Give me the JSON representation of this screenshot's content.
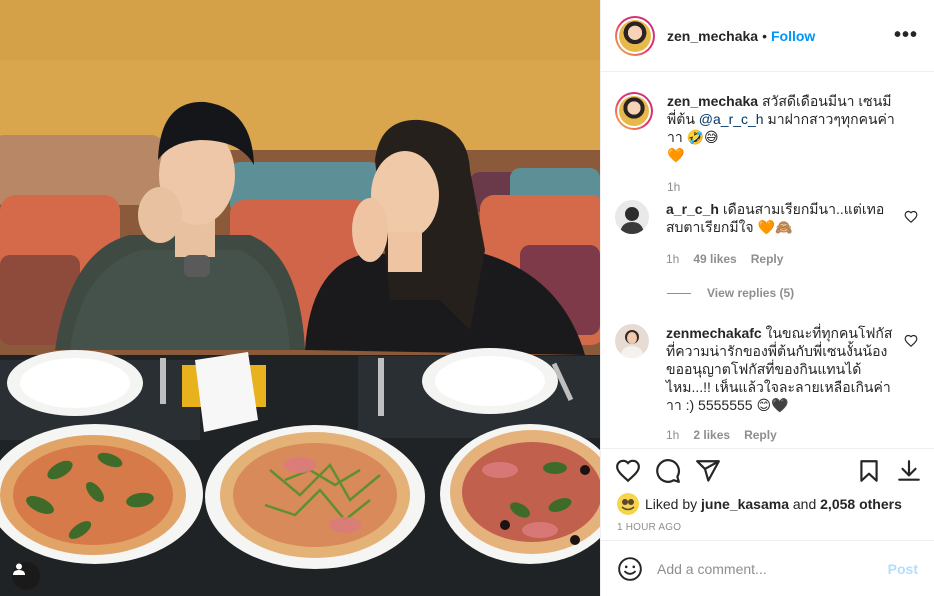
{
  "header": {
    "username": "zen_mechaka",
    "separator": "•",
    "follow_label": "Follow",
    "more_label": "•••"
  },
  "caption": {
    "username": "zen_mechaka",
    "text_before": "สวัสดีเดือนมีนา เซนมีพี่ต้น",
    "mention": "@a_r_c_h",
    "text_after": "มาฝากสาวๆทุกคนค่าาา 🤣😅",
    "emoji_line": "🧡",
    "time": "1h"
  },
  "comments": [
    {
      "username": "a_r_c_h",
      "text": "เดือนสามเรียกมีนา..แต่เทอสบตาเรียกมีใจ 🧡🙈",
      "time": "1h",
      "likes": "49 likes",
      "reply_label": "Reply"
    },
    {
      "username": "zenmechakafc",
      "text": "ในขณะที่ทุกคนโฟกัสที่ความน่ารักของพี่ต้นกับพี่เซนงั้นน้องขออนุญาตโฟกัสที่ของกินแทนได้ไหม...!! เห็นแล้วใจละลายเหลือเกินค่าาา :) 5555555 😊🖤",
      "time": "1h",
      "likes": "2 likes",
      "reply_label": "Reply"
    }
  ],
  "view_replies_label": "View replies (5)",
  "likes": {
    "prefix": "Liked by",
    "user": "june_kasama",
    "joiner": "and",
    "others": "2,058 others"
  },
  "time_ago": "1 HOUR AGO",
  "add_comment": {
    "placeholder": "Add a comment...",
    "post_label": "Post"
  },
  "icons": {
    "like": "heart-icon",
    "comment": "speech-bubble-icon",
    "share": "paper-plane-icon",
    "save": "bookmark-icon",
    "download": "download-icon",
    "emoji": "smiley-icon",
    "tag": "user-tag-icon"
  },
  "colors": {
    "follow": "#0095f6",
    "post_disabled": "#b2dffc",
    "secondary_text": "#8e8e8e",
    "mention": "#00376b"
  }
}
